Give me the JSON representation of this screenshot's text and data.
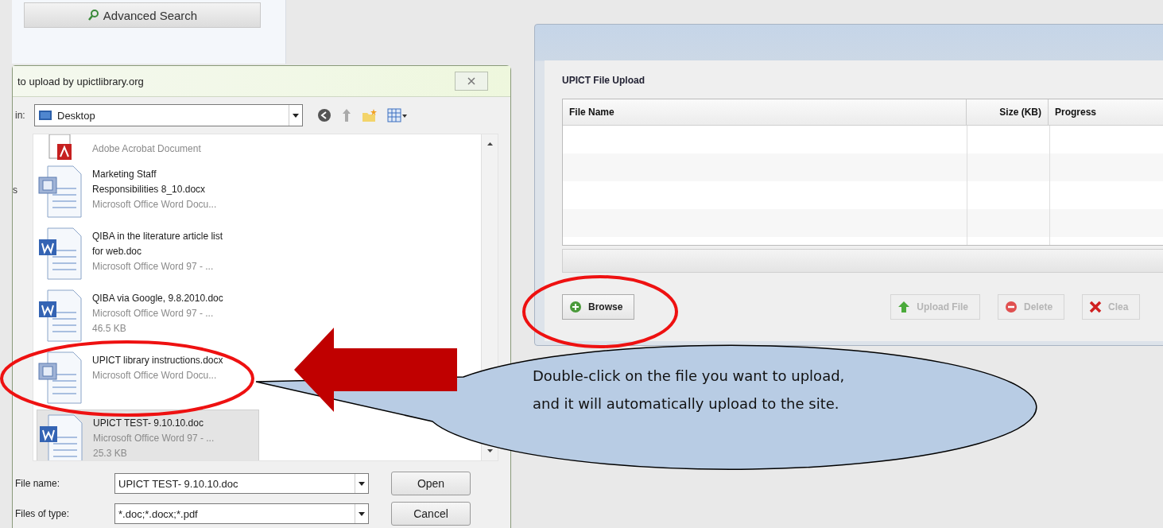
{
  "search_panel": {
    "button": "Advanced Search"
  },
  "file_dialog": {
    "title": "to upload by upictlibrary.org",
    "places_label": "s",
    "look_in": {
      "label": "in:",
      "value": "Desktop"
    },
    "files": [
      {
        "kind": "pdf",
        "type": "Adobe Acrobat Document",
        "selected": false
      },
      {
        "kind": "docx",
        "name": "Marketing Staff Responsibilities 8_10.docx",
        "type": "Microsoft Office Word Docu...",
        "selected": false
      },
      {
        "kind": "doc",
        "name": "QIBA in the literature article list for web.doc",
        "type": "Microsoft Office Word 97 - ...",
        "selected": false
      },
      {
        "kind": "doc",
        "name": "QIBA via Google, 9.8.2010.doc",
        "type": "Microsoft Office Word 97 - ...",
        "size": "46.5 KB",
        "selected": false
      },
      {
        "kind": "docx",
        "name": "UPICT library instructions.docx",
        "type": "Microsoft Office Word Docu...",
        "selected": false
      },
      {
        "kind": "doc",
        "name": "UPICT TEST- 9.10.10.doc",
        "type": "Microsoft Office Word 97 - ...",
        "size": "25.3 KB",
        "selected": true
      }
    ],
    "file_name": {
      "label": "File name:",
      "value": "UPICT TEST- 9.10.10.doc"
    },
    "file_type": {
      "label": "Files of type:",
      "value": "*.doc;*.docx;*.pdf"
    },
    "buttons": [
      "Open",
      "Cancel"
    ]
  },
  "upload_panel": {
    "title": "UPICT File Upload",
    "columns": [
      "File Name",
      "Size (KB)",
      "Progress"
    ],
    "buttons": [
      {
        "kind": "add",
        "label": "Browse",
        "disabled": false
      },
      {
        "kind": "upload",
        "label": "Upload File",
        "disabled": true
      },
      {
        "kind": "delete",
        "label": "Delete",
        "disabled": true
      },
      {
        "kind": "clear",
        "label": "Clea",
        "disabled": true
      }
    ]
  },
  "callout": {
    "lines": [
      "Double-click on the file you want to upload,",
      "and it will automatically upload to the site."
    ]
  }
}
